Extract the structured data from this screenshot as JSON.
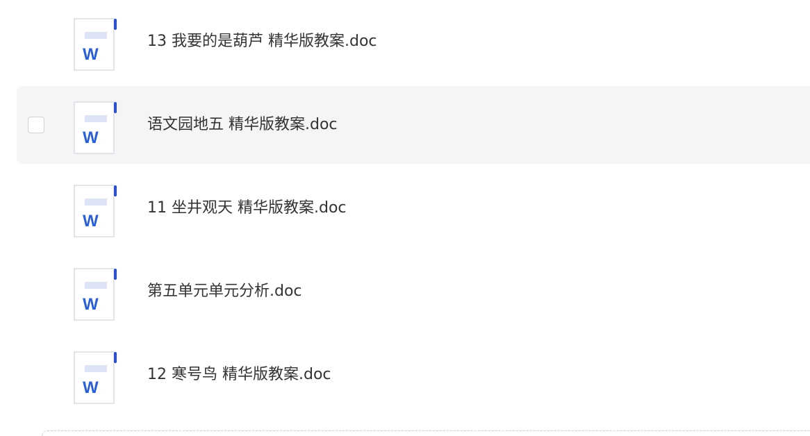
{
  "files": [
    {
      "name": "13 我要的是葫芦 精华版教案.doc",
      "icon": "word-doc-icon",
      "selected": false
    },
    {
      "name": "语文园地五 精华版教案.doc",
      "icon": "word-doc-icon",
      "selected": true
    },
    {
      "name": "11 坐井观天 精华版教案.doc",
      "icon": "word-doc-icon",
      "selected": false
    },
    {
      "name": "第五单元单元分析.doc",
      "icon": "word-doc-icon",
      "selected": false
    },
    {
      "name": "12 寒号鸟 精华版教案.doc",
      "icon": "word-doc-icon",
      "selected": false
    }
  ],
  "icon_letter": "W",
  "colors": {
    "word_blue": "#2b5fd9",
    "accent_bar": "#2b4fc7",
    "stripe": "#dde3f5",
    "row_hover": "#f5f5f6"
  }
}
